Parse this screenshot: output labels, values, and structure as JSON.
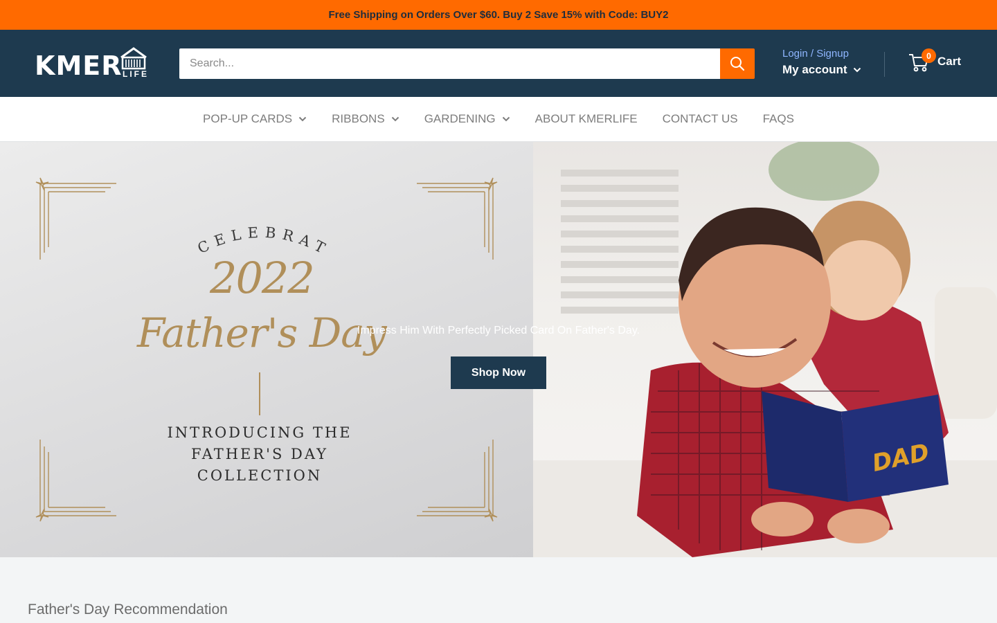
{
  "announcement": {
    "text": "Free Shipping on Orders Over $60. Buy 2 Save 15% with Code: BUY2"
  },
  "header": {
    "logo": {
      "brand": "KMER",
      "sub": "LIFE",
      "icon": "house-logo-icon"
    },
    "search": {
      "placeholder": "Search...",
      "value": "",
      "button_icon": "search-icon"
    },
    "account": {
      "login_text": "Login / Signup",
      "my_account_label": "My account"
    },
    "cart": {
      "count": "0",
      "label": "Cart",
      "icon": "cart-icon"
    }
  },
  "nav": {
    "items": [
      {
        "label": "POP-UP CARDS",
        "has_dropdown": true
      },
      {
        "label": "RIBBONS",
        "has_dropdown": true
      },
      {
        "label": "GARDENING",
        "has_dropdown": true
      },
      {
        "label": "ABOUT KMERLIFE",
        "has_dropdown": false
      },
      {
        "label": "CONTACT US",
        "has_dropdown": false
      },
      {
        "label": "FAQS",
        "has_dropdown": false
      }
    ]
  },
  "hero": {
    "celebrate": "CELEBRATE",
    "year": "2022",
    "script": "Father's Day",
    "intro_lines": [
      "INTRODUCING THE",
      "FATHER'S DAY",
      "COLLECTION"
    ],
    "tagline": "Impress Him With Perfectly Picked Card On Father's Day.",
    "button_label": "Shop Now",
    "card_text": "DAD"
  },
  "section": {
    "title": "Father's Day Recommendation"
  },
  "colors": {
    "accent": "#ff6a00",
    "header_bg": "#1e3a4f",
    "gold": "#b08f5a",
    "link": "#8fb6ff"
  }
}
